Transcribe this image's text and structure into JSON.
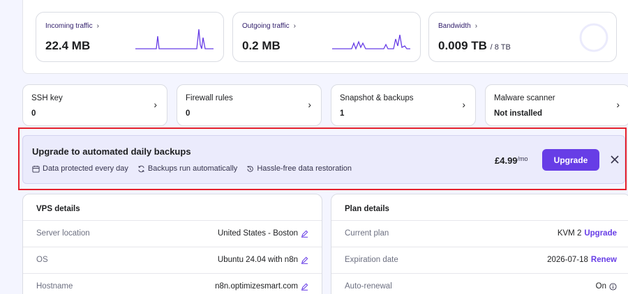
{
  "traffic": {
    "incoming": {
      "label": "Incoming traffic",
      "value": "22.4 MB"
    },
    "outgoing": {
      "label": "Outgoing traffic",
      "value": "0.2 MB"
    },
    "bandwidth": {
      "label": "Bandwidth",
      "value": "0.009 TB",
      "total": "/ 8 TB"
    }
  },
  "stats": [
    {
      "label": "SSH key",
      "value": "0"
    },
    {
      "label": "Firewall rules",
      "value": "0"
    },
    {
      "label": "Snapshot & backups",
      "value": "1"
    },
    {
      "label": "Malware scanner",
      "value": "Not installed"
    }
  ],
  "banner": {
    "title": "Upgrade to automated daily backups",
    "features": [
      "Data protected every day",
      "Backups run automatically",
      "Hassle-free data restoration"
    ],
    "price": "£4.99",
    "per": "/mo",
    "button": "Upgrade"
  },
  "vps": {
    "title": "VPS details",
    "rows": [
      {
        "key": "Server location",
        "value": "United States - Boston"
      },
      {
        "key": "OS",
        "value": "Ubuntu 24.04 with n8n"
      },
      {
        "key": "Hostname",
        "value": "n8n.optimizesmart.com"
      }
    ]
  },
  "plan": {
    "title": "Plan details",
    "rows": [
      {
        "key": "Current plan",
        "value": "KVM 2",
        "action": "Upgrade"
      },
      {
        "key": "Expiration date",
        "value": "2026-07-18",
        "action": "Renew"
      },
      {
        "key": "Auto-renewal",
        "value": "On"
      }
    ]
  },
  "colors": {
    "accent": "#673de6",
    "highlight": "#e5202c",
    "banner_bg": "#ebebfc"
  }
}
